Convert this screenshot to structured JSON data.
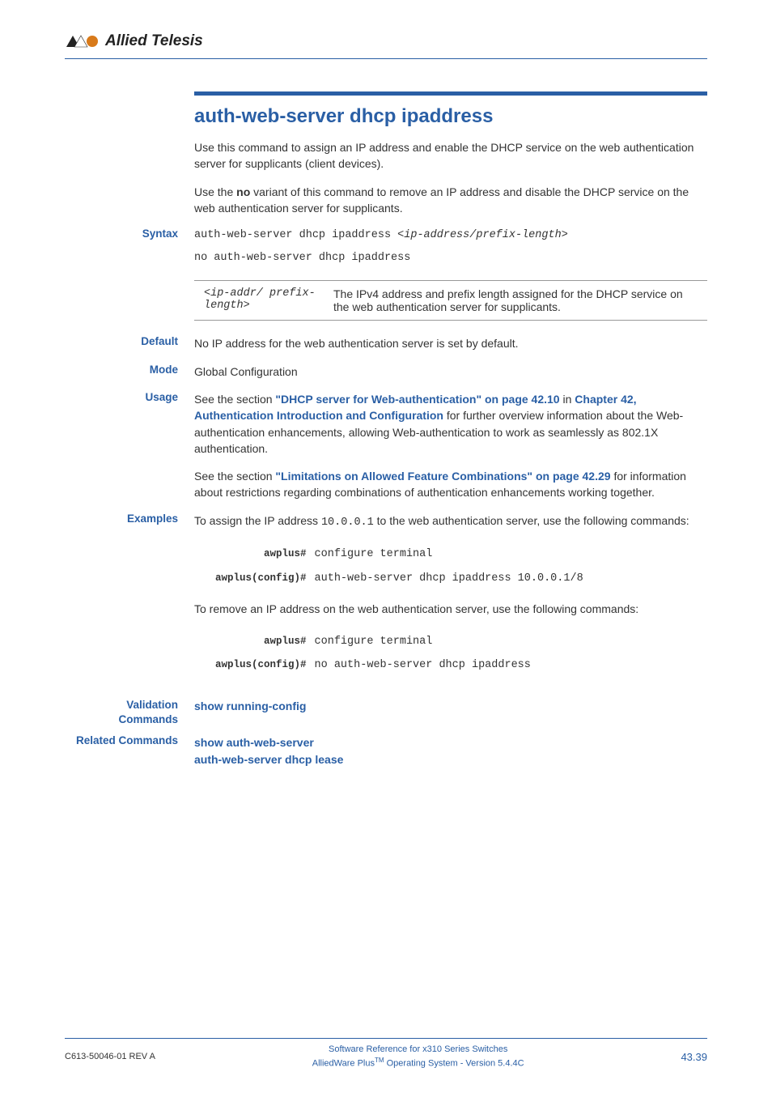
{
  "header": {
    "brand": "Allied Telesis"
  },
  "command_title": "auth-web-server dhcp ipaddress",
  "intro": {
    "p1": "Use this command to assign an IP address and enable the DHCP service on the web authentication server for supplicants (client devices).",
    "p2_pre": "Use the ",
    "p2_bold": "no",
    "p2_post": " variant of this command to remove an IP address and disable the DHCP service on the web authentication server for supplicants."
  },
  "syntax": {
    "label": "Syntax",
    "line1_pre": "auth-web-server dhcp ipaddress <",
    "line1_arg": "ip-address/prefix-length",
    "line1_post": ">",
    "line2": "no auth-web-server dhcp ipaddress"
  },
  "param": {
    "name": "<ip-addr/ prefix-length>",
    "desc": "The IPv4 address and prefix length assigned for the DHCP service on the web authentication server for supplicants."
  },
  "default": {
    "label": "Default",
    "text": "No IP address for the web authentication server is set by default."
  },
  "mode": {
    "label": "Mode",
    "text": "Global Configuration"
  },
  "usage": {
    "label": "Usage",
    "p1_a": "See the section ",
    "p1_link1": "\"DHCP server for Web-authentication\" on page 42.10",
    "p1_b": " in ",
    "p1_link2": "Chapter 42, Authentication Introduction and Configuration",
    "p1_c": " for further overview information about the Web-authentication enhancements, allowing Web-authentication to work as seamlessly as 802.1X authentication.",
    "p2_a": "See the section ",
    "p2_link": "\"Limitations on Allowed Feature Combinations\" on page 42.29",
    "p2_b": " for information about restrictions regarding combinations of authentication enhancements working together."
  },
  "examples": {
    "label": "Examples",
    "p1_a": "To assign the IP address ",
    "p1_ip": "10.0.0.1",
    "p1_b": " to the web authentication server, use the following commands:",
    "cmd1": {
      "r1_prompt": "awplus#",
      "r1_cmd": "configure terminal",
      "r2_prompt": "awplus(config)#",
      "r2_cmd": "auth-web-server dhcp ipaddress 10.0.0.1/8"
    },
    "p2": "To remove an IP address on the web authentication server, use the following commands:",
    "cmd2": {
      "r1_prompt": "awplus#",
      "r1_cmd": "configure terminal",
      "r2_prompt": "awplus(config)#",
      "r2_cmd": "no auth-web-server dhcp ipaddress"
    }
  },
  "validation": {
    "label1": "Validation",
    "label2": "Commands",
    "link": "show running-config"
  },
  "related": {
    "label": "Related Commands",
    "link1": "show auth-web-server",
    "link2": "auth-web-server dhcp lease"
  },
  "footer": {
    "left": "C613-50046-01 REV A",
    "center1": "Software Reference for x310 Series Switches",
    "center2_a": "AlliedWare Plus",
    "center2_tm": "TM",
    "center2_b": " Operating System - Version 5.4.4C",
    "right": "43.39"
  }
}
